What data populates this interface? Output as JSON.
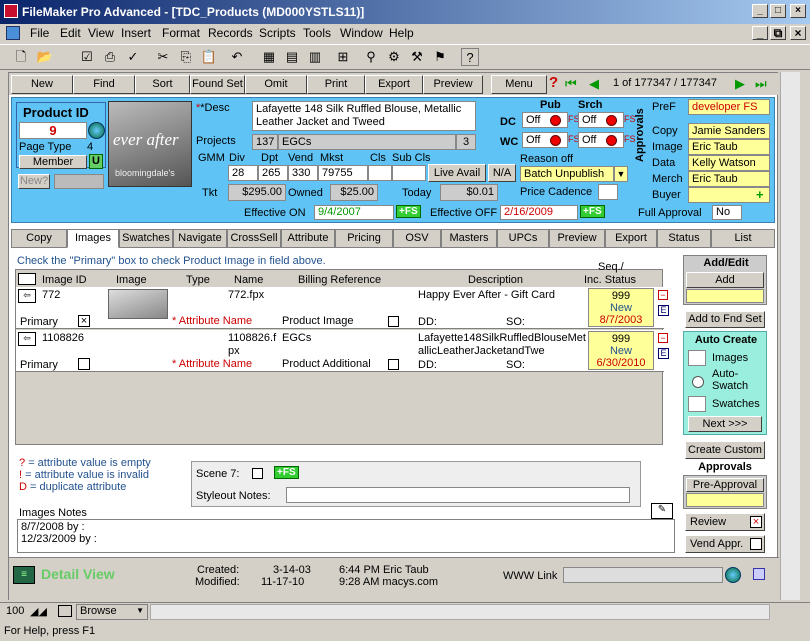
{
  "window": {
    "title": "FileMaker Pro Advanced - [TDC_Products (MD000YSTLS11)]"
  },
  "menu": [
    "File",
    "Edit",
    "View",
    "Insert",
    "Format",
    "Records",
    "Scripts",
    "Tools",
    "Window",
    "Help"
  ],
  "nav": {
    "new": "New",
    "find": "Find",
    "sort": "Sort",
    "found_set": "Found Set",
    "omit": "Omit",
    "print": "Print",
    "export": "Export",
    "preview": "Preview",
    "menu": "Menu",
    "record_count": "1 of 177347 / 177347"
  },
  "product": {
    "id_label": "Product ID",
    "id": "9",
    "page_type_label": "Page Type",
    "page_type": "4",
    "member": "Member",
    "member_flag": "U",
    "new_q": "New?"
  },
  "image_text": {
    "brand": "ever after",
    "store": "bloomingdale's"
  },
  "desc": {
    "label": "*Desc",
    "value": "Lafayette 148 Silk Ruffled Blouse, Metallic Leather Jacket and Tweed"
  },
  "projects": {
    "label": "Projects",
    "code": "137",
    "name": "EGCs",
    "count": "3"
  },
  "hier": {
    "gmm": "GMM",
    "div_label": "Div",
    "dpt_label": "Dpt",
    "vend_label": "Vend",
    "mkst_label": "Mkst",
    "cls_label": "Cls",
    "subcls_label": "Sub Cls",
    "div": "28",
    "dpt": "265",
    "vend": "330",
    "mkst": "79755"
  },
  "price": {
    "tkt_label": "Tkt",
    "tkt": "$295.00",
    "owned_label": "Owned",
    "owned": "$25.00",
    "today_label": "Today",
    "today": "$0.01",
    "live_avail": "Live Avail",
    "na": "N/A",
    "cadence_label": "Price Cadence"
  },
  "effective": {
    "on_label": "Effective ON",
    "on": "9/4/2007",
    "off_label": "Effective OFF",
    "off": "2/16/2009",
    "fs": "+FS"
  },
  "publish": {
    "pub": "Pub",
    "srch": "Srch",
    "dc": "DC",
    "wc": "WC",
    "off": "Off",
    "fs": "FS",
    "reason_label": "Reason off",
    "reason": "Batch Unpublish"
  },
  "approvals": {
    "vertical": "Approvals",
    "pref_label": "PreF",
    "pref": "developer FS",
    "copy_label": "Copy",
    "copy": "Jamie Sanders",
    "image_label": "Image",
    "image": "Eric Taub",
    "data_label": "Data",
    "data": "Kelly Watson",
    "merch_label": "Merch",
    "merch": "Eric Taub",
    "buyer_label": "Buyer",
    "full_label": "Full Approval",
    "full": "No"
  },
  "tabs": [
    "Copy",
    "Images",
    "Swatches",
    "Navigate",
    "CrossSell",
    "Attribute",
    "Pricing",
    "OSV",
    "Masters",
    "UPCs",
    "Preview",
    "Export",
    "Status",
    "List"
  ],
  "images": {
    "instruction": "Check the \"Primary\" box to check Product Image in field above.",
    "cols": {
      "id": "Image ID",
      "image": "Image",
      "type": "Type",
      "name": "Name",
      "billing": "Billing Reference",
      "desc": "Description",
      "seq": "Seq./",
      "status": "Inc. Status"
    },
    "rows": [
      {
        "id": "772",
        "primary": "Primary",
        "checked": true,
        "attr": "* Attribute Name",
        "name": "772.fpx",
        "billing": "Product Image",
        "desc": "Happy Ever After - Gift Card",
        "dd": "DD:",
        "so": "SO:",
        "seq": "999",
        "status": "New",
        "date": "8/7/2003"
      },
      {
        "id": "1108826",
        "primary": "Primary",
        "checked": false,
        "attr": "* Attribute Name",
        "name": "1108826.fpx",
        "billing": "EGCs",
        "billing2": "Product Additional",
        "desc": "Lafayette148SilkRuffledBlouseMetallicLeatherJacketandTwe",
        "dd": "DD:",
        "so": "SO:",
        "seq": "999",
        "status": "New",
        "date": "6/30/2010"
      }
    ],
    "legend": [
      {
        "sym": "?",
        "txt": "= attribute value is empty"
      },
      {
        "sym": "!",
        "txt": "= attribute value is invalid"
      },
      {
        "sym": "D",
        "txt": "= duplicate attribute"
      }
    ],
    "scene_label": "Scene 7:",
    "styleout_label": "Styleout Notes:",
    "notes_label": "Images Notes",
    "notes": [
      "8/7/2008 by :",
      "12/23/2009 by :"
    ]
  },
  "side": {
    "add_edit": "Add/Edit",
    "add": "Add",
    "add_fnd": "Add to Fnd Set",
    "auto_create": "Auto Create",
    "images": "Images",
    "auto_swatch": "Auto-Swatch",
    "swatches": "Swatches",
    "next": "Next >>>",
    "create_custom": "Create Custom",
    "approvals": "Approvals",
    "pre_approval": "Pre-Approval",
    "review": "Review",
    "vend_appr": "Vend Appr."
  },
  "footer": {
    "view": "Detail View",
    "created_label": "Created:",
    "created_date": "3-14-03",
    "created_time": "6:44 PM Eric Taub",
    "modified_label": "Modified:",
    "modified_date": "11-17-10",
    "modified_time": "9:28 AM macys.com",
    "www": "WWW Link"
  },
  "bottom": {
    "zoom": "100",
    "mode": "Browse",
    "status": "For Help, press F1"
  }
}
